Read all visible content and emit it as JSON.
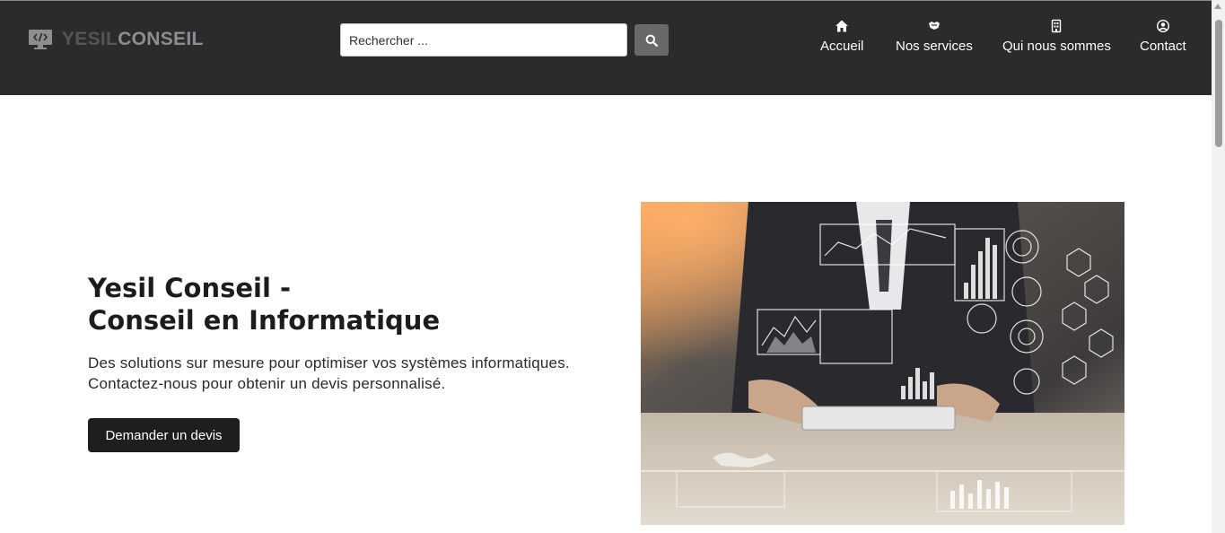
{
  "header": {
    "logo": {
      "part1": "YESIL",
      "part2": "CONSEIL",
      "icon": "code-monitor-icon"
    },
    "search": {
      "placeholder": "Rechercher ...",
      "value": "",
      "button_icon": "search-icon"
    },
    "nav": [
      {
        "label": "Accueil",
        "icon": "home-icon"
      },
      {
        "label": "Nos services",
        "icon": "services-icon"
      },
      {
        "label": "Qui nous sommes",
        "icon": "building-icon"
      },
      {
        "label": "Contact",
        "icon": "user-circle-icon"
      }
    ]
  },
  "hero": {
    "title_line1": "Yesil Conseil -",
    "title_line2": "Conseil en Informatique",
    "desc_line1": "Des solutions sur mesure pour optimiser vos systèmes informatiques.",
    "desc_line2": "Contactez-nous pour obtenir un devis personnalisé.",
    "cta_label": "Demander un devis",
    "image_alt": "business-analytics-photo"
  },
  "colors": {
    "header_bg": "#2b2a2c",
    "button_dark": "#1e1e20",
    "search_button": "#6b6869",
    "text_dark": "#1c1b1d"
  }
}
